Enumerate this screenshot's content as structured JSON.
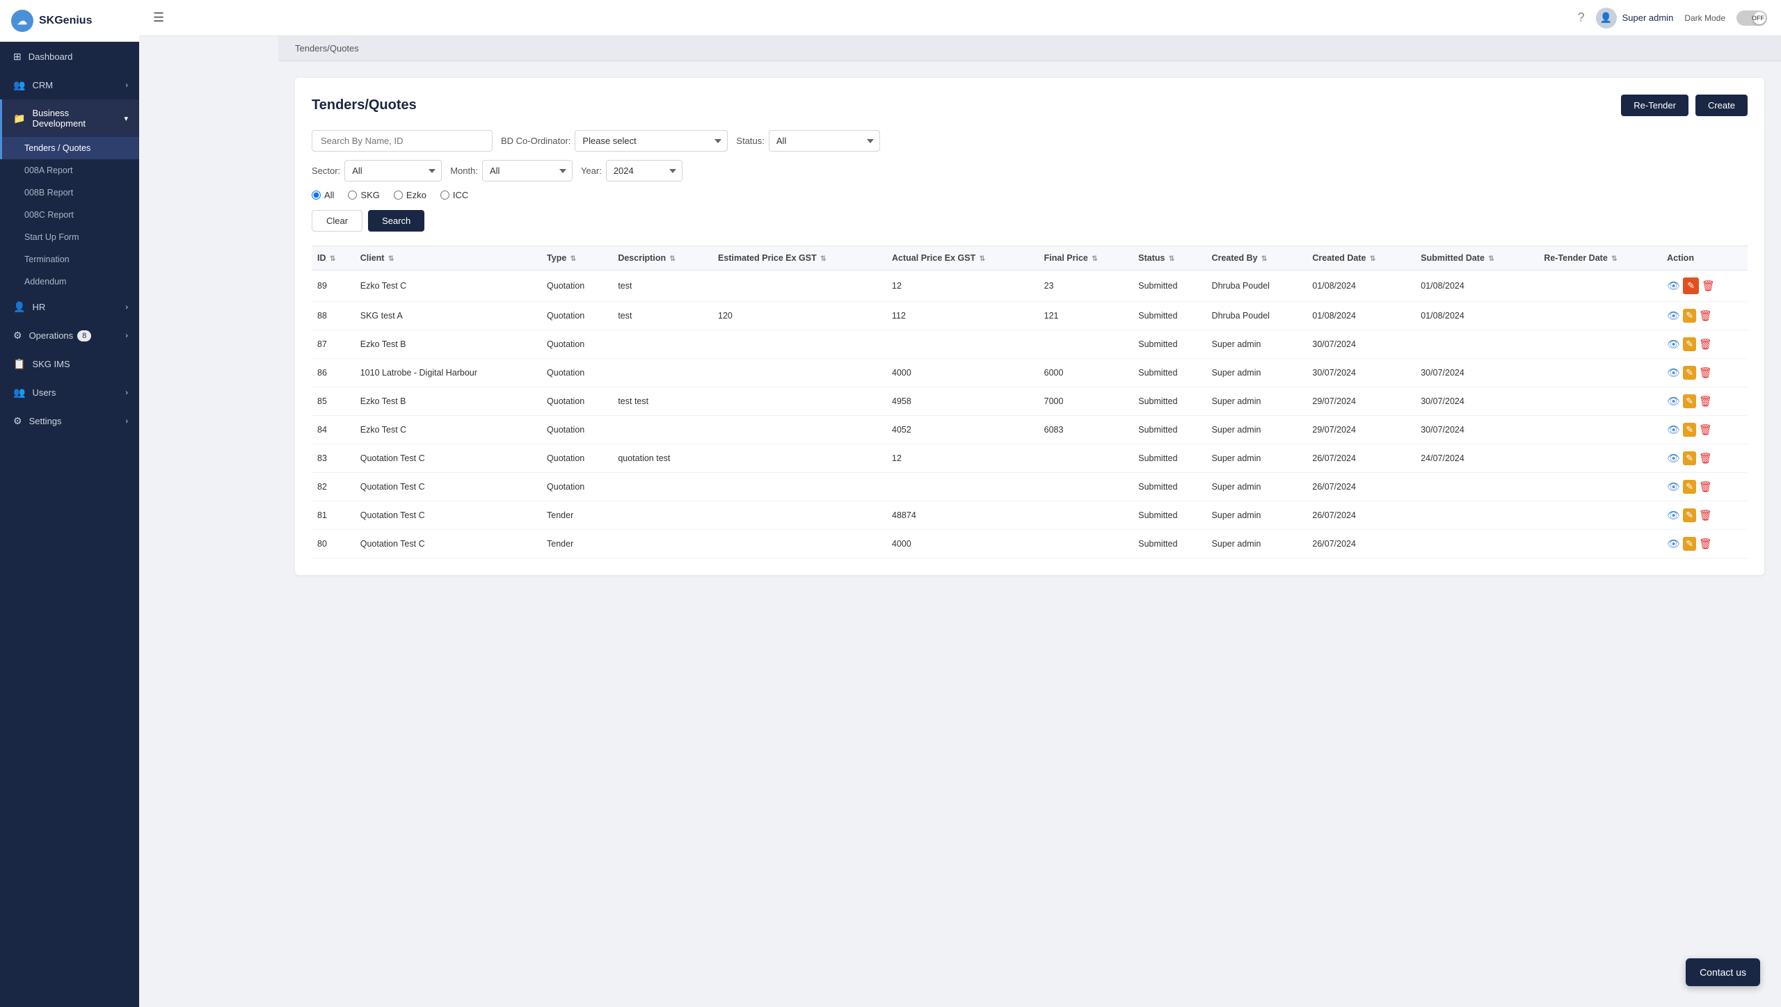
{
  "app": {
    "name": "SKGenius",
    "logo_initial": "☁"
  },
  "topbar": {
    "hamburger_icon": "☰",
    "user_name": "Super admin",
    "dark_mode_label": "Dark Mode",
    "dark_mode_state": "OFF",
    "help_icon": "?"
  },
  "breadcrumb": "Tenders/Quotes",
  "sidebar": {
    "items": [
      {
        "id": "dashboard",
        "label": "Dashboard",
        "icon": "⊞",
        "has_arrow": false
      },
      {
        "id": "crm",
        "label": "CRM",
        "icon": "👥",
        "has_arrow": true
      },
      {
        "id": "business-development",
        "label": "Business Development",
        "icon": "📁",
        "has_arrow": true,
        "expanded": true
      },
      {
        "id": "tenders-quotes",
        "label": "Tenders / Quotes",
        "sub": true,
        "active": true
      },
      {
        "id": "008a-report",
        "label": "008A Report",
        "sub": true
      },
      {
        "id": "008b-report",
        "label": "008B Report",
        "sub": true
      },
      {
        "id": "008c-report",
        "label": "008C Report",
        "sub": true
      },
      {
        "id": "startup-form",
        "label": "Start Up Form",
        "sub": true
      },
      {
        "id": "termination",
        "label": "Termination",
        "sub": true
      },
      {
        "id": "addendum",
        "label": "Addendum",
        "sub": true
      },
      {
        "id": "hr",
        "label": "HR",
        "icon": "👤",
        "has_arrow": true
      },
      {
        "id": "operations",
        "label": "Operations",
        "icon": "⚙",
        "has_arrow": true,
        "badge": "8"
      },
      {
        "id": "skg-ims",
        "label": "SKG IMS",
        "icon": "📋",
        "has_arrow": false
      },
      {
        "id": "users",
        "label": "Users",
        "icon": "👥",
        "has_arrow": true
      },
      {
        "id": "settings",
        "label": "Settings",
        "icon": "⚙",
        "has_arrow": true
      }
    ]
  },
  "page": {
    "title": "Tenders/Quotes",
    "retender_label": "Re-Tender",
    "create_label": "Create"
  },
  "filters": {
    "search_placeholder": "Search By Name, ID",
    "bd_coordinator_label": "BD Co-Ordinator:",
    "bd_coordinator_placeholder": "Please select",
    "status_label": "Status:",
    "status_value": "All",
    "sector_label": "Sector:",
    "sector_value": "All",
    "month_label": "Month:",
    "month_value": "All",
    "year_label": "Year:",
    "year_value": "2024",
    "radio_options": [
      "All",
      "SKG",
      "Ezko",
      "ICC"
    ],
    "radio_selected": "All",
    "clear_label": "Clear",
    "search_label": "Search"
  },
  "table": {
    "columns": [
      {
        "key": "id",
        "label": "ID"
      },
      {
        "key": "client",
        "label": "Client"
      },
      {
        "key": "type",
        "label": "Type"
      },
      {
        "key": "description",
        "label": "Description"
      },
      {
        "key": "estimated_price",
        "label": "Estimated Price Ex GST"
      },
      {
        "key": "actual_price",
        "label": "Actual Price Ex GST"
      },
      {
        "key": "final_price",
        "label": "Final Price"
      },
      {
        "key": "status",
        "label": "Status"
      },
      {
        "key": "created_by",
        "label": "Created By"
      },
      {
        "key": "created_date",
        "label": "Created Date"
      },
      {
        "key": "submitted_date",
        "label": "Submitted Date"
      },
      {
        "key": "retender_date",
        "label": "Re-Tender Date"
      },
      {
        "key": "action",
        "label": "Action"
      }
    ],
    "rows": [
      {
        "id": "89",
        "client": "Ezko Test C",
        "type": "Quotation",
        "description": "test",
        "estimated_price": "",
        "actual_price": "12",
        "final_price": "23",
        "status": "Submitted",
        "created_by": "Dhruba Poudel",
        "created_date": "01/08/2024",
        "submitted_date": "01/08/2024",
        "retender_date": "",
        "highlight_edit": true
      },
      {
        "id": "88",
        "client": "SKG test A",
        "type": "Quotation",
        "description": "test",
        "estimated_price": "120",
        "actual_price": "112",
        "final_price": "121",
        "status": "Submitted",
        "created_by": "Dhruba Poudel",
        "created_date": "01/08/2024",
        "submitted_date": "01/08/2024",
        "retender_date": ""
      },
      {
        "id": "87",
        "client": "Ezko Test B",
        "type": "Quotation",
        "description": "",
        "estimated_price": "",
        "actual_price": "",
        "final_price": "",
        "status": "Submitted",
        "created_by": "Super admin",
        "created_date": "30/07/2024",
        "submitted_date": "",
        "retender_date": ""
      },
      {
        "id": "86",
        "client": "1010 Latrobe - Digital Harbour",
        "type": "Quotation",
        "description": "",
        "estimated_price": "",
        "actual_price": "4000",
        "final_price": "6000",
        "status": "Submitted",
        "created_by": "Super admin",
        "created_date": "30/07/2024",
        "submitted_date": "30/07/2024",
        "retender_date": ""
      },
      {
        "id": "85",
        "client": "Ezko Test B",
        "type": "Quotation",
        "description": "test test",
        "estimated_price": "",
        "actual_price": "4958",
        "final_price": "7000",
        "status": "Submitted",
        "created_by": "Super admin",
        "created_date": "29/07/2024",
        "submitted_date": "30/07/2024",
        "retender_date": ""
      },
      {
        "id": "84",
        "client": "Ezko Test C",
        "type": "Quotation",
        "description": "",
        "estimated_price": "",
        "actual_price": "4052",
        "final_price": "6083",
        "status": "Submitted",
        "created_by": "Super admin",
        "created_date": "29/07/2024",
        "submitted_date": "30/07/2024",
        "retender_date": ""
      },
      {
        "id": "83",
        "client": "Quotation Test C",
        "type": "Quotation",
        "description": "quotation test",
        "estimated_price": "",
        "actual_price": "12",
        "final_price": "",
        "status": "Submitted",
        "created_by": "Super admin",
        "created_date": "26/07/2024",
        "submitted_date": "24/07/2024",
        "retender_date": ""
      },
      {
        "id": "82",
        "client": "Quotation Test C",
        "type": "Quotation",
        "description": "",
        "estimated_price": "",
        "actual_price": "",
        "final_price": "",
        "status": "Submitted",
        "created_by": "Super admin",
        "created_date": "26/07/2024",
        "submitted_date": "",
        "retender_date": ""
      },
      {
        "id": "81",
        "client": "Quotation Test C",
        "type": "Tender",
        "description": "",
        "estimated_price": "",
        "actual_price": "48874",
        "final_price": "",
        "status": "Submitted",
        "created_by": "Super admin",
        "created_date": "26/07/2024",
        "submitted_date": "",
        "retender_date": ""
      },
      {
        "id": "80",
        "client": "Quotation Test C",
        "type": "Tender",
        "description": "",
        "estimated_price": "",
        "actual_price": "4000",
        "final_price": "",
        "status": "Submitted",
        "created_by": "Super admin",
        "created_date": "26/07/2024",
        "submitted_date": "",
        "retender_date": ""
      }
    ]
  },
  "contact_us": "Contact us"
}
